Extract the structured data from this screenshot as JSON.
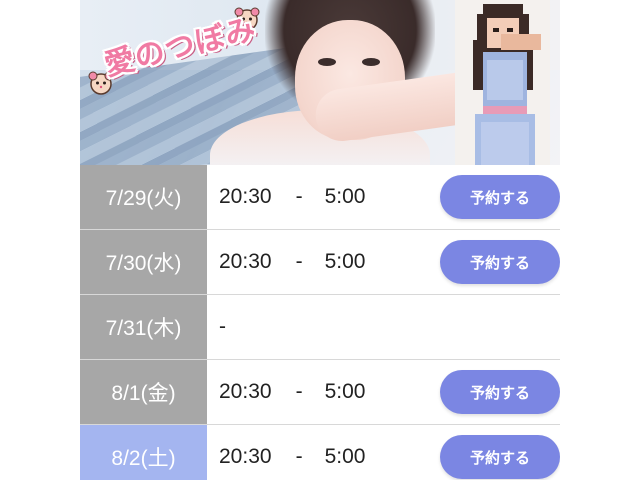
{
  "banner": {
    "logo_text": "愛のつぼみ"
  },
  "schedule": {
    "rows": [
      {
        "date": "7/29(火)",
        "start": "20:30",
        "separator": "-",
        "end": "5:00",
        "button": "予約する",
        "today": false
      },
      {
        "date": "7/30(水)",
        "start": "20:30",
        "separator": "-",
        "end": "5:00",
        "button": "予約する",
        "today": false
      },
      {
        "date": "7/31(木)",
        "start": "",
        "separator": "-",
        "end": "",
        "button": "",
        "today": false
      },
      {
        "date": "8/1(金)",
        "start": "20:30",
        "separator": "-",
        "end": "5:00",
        "button": "予約する",
        "today": false
      },
      {
        "date": "8/2(土)",
        "start": "20:30",
        "separator": "-",
        "end": "5:00",
        "button": "予約する",
        "today": true
      }
    ]
  },
  "colors": {
    "date_cell": "#a7a7a7",
    "date_cell_today": "#a4b5f0",
    "button": "#7b86e3",
    "logo": "#f07aa3"
  }
}
